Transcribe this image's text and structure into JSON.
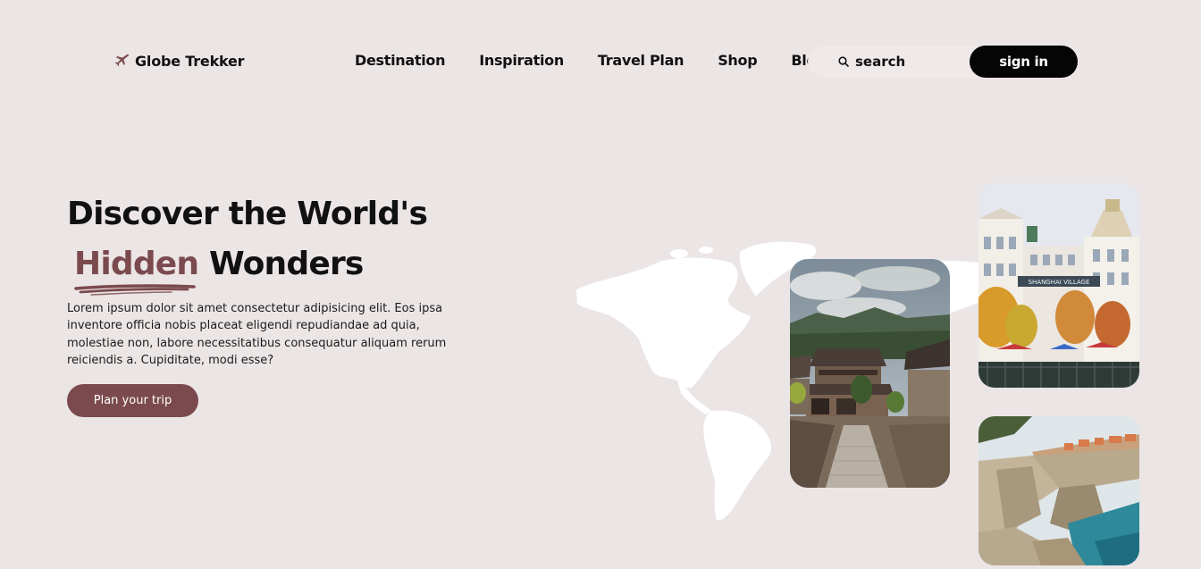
{
  "brand": {
    "name": "Globe Trekker",
    "icon": "airplane-icon"
  },
  "nav": {
    "items": [
      {
        "label": "Destination"
      },
      {
        "label": "Inspiration"
      },
      {
        "label": "Travel Plan"
      },
      {
        "label": "Shop"
      },
      {
        "label": "Blog"
      }
    ]
  },
  "search": {
    "placeholder": "search",
    "icon": "search-icon"
  },
  "auth": {
    "signin_label": "sign in"
  },
  "hero": {
    "title_line1": "Discover the World's",
    "title_accent": "Hidden",
    "title_rest": " Wonders",
    "description": "Lorem ipsum dolor sit amet consectetur adipisicing elit. Eos ipsa inventore officia nobis placeat eligendi repudiandae ad quia, molestiae non, labore necessitatibus consequatur aliquam rerum reiciendis a. Cupiditate, modi esse?",
    "cta_label": "Plan your trip"
  },
  "gallery": {
    "sign_text": "SHANGHAI VILLAGE"
  },
  "colors": {
    "background": "#ece5e5",
    "accent": "#7b4a4e",
    "dark": "#050505"
  }
}
